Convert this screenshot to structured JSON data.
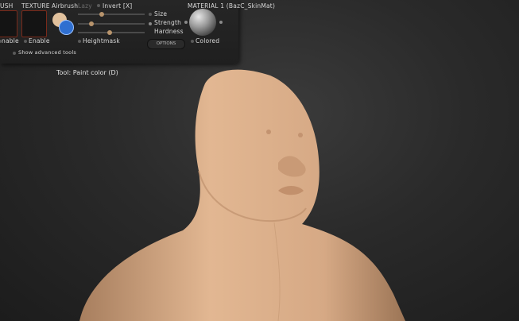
{
  "toolbar": {
    "brush_label": "USH",
    "texture_label": "TEXTURE",
    "airbrush_label": "Airbrush",
    "lazy_label": "Lazy",
    "invert_label": "Invert [X]",
    "size_label": "Size",
    "strength_label": "Strength",
    "hardness_label": "Hardness",
    "enable_brush_label": "nable",
    "enable_texture_label": "Enable",
    "heightmask_label": "Heightmask",
    "options_label": "OPTIONS",
    "material_label": "MATERIAL 1 (BazC_SkinMat)",
    "colored_label": "Colored",
    "advanced_label": "Show advanced tools",
    "size_value": 0.36,
    "strength_value": 0.2,
    "hardness_value": 0.48
  },
  "viewport": {
    "tool_label": "Tool: Paint color (D)"
  },
  "colors": {
    "accent": "#2f6fd0",
    "skin": "#d9ac86",
    "paint": "#e1c19d"
  }
}
